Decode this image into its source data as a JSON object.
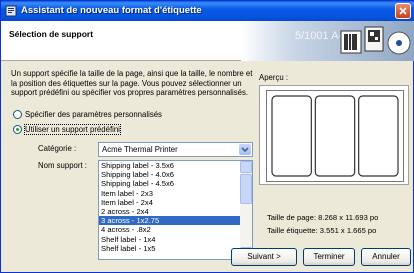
{
  "window": {
    "title": "Assistant de nouveau format d'étiquette",
    "colors": {
      "titlebar": "#0655e0",
      "selection": "#316ac5",
      "radio_dot": "#21a121"
    }
  },
  "header": {
    "title": "Sélection de support",
    "banner_text": "5/1001 A-11"
  },
  "description": "Un support spécifie la taille de la page, ainsi que la taille, le nombre et la position des étiquettes sur la page. Vous pouvez sélectionner un support prédéfini ou spécifier vos propres paramètres personnalisés.",
  "options": {
    "custom": {
      "label": "Spécifier des paramètres personnalisés",
      "selected": false
    },
    "predefined": {
      "label": "Utiliser un support prédéfini",
      "selected": true
    }
  },
  "category": {
    "label": "Catégorie :",
    "value": "Acme Thermal Printer"
  },
  "media": {
    "label": "Nom support :",
    "items": [
      "Shipping label - 3.5x6",
      "Shipping label - 4.0x6",
      "Shipping label - 4.5x6",
      "Item label - 2x3",
      "Item label - 2x4",
      "2 across - 2x4",
      "3 across - 1x2.75",
      "4 across - .8x2",
      "Shelf label - 1x4",
      "Shelf label - 1x5"
    ],
    "selected_index": 6
  },
  "preview": {
    "label": "Aperçu :",
    "label_columns": 3
  },
  "dimensions": {
    "page_label": "Taille de page:",
    "page_value": "8.268 x 11.693 po",
    "label_label": "Taille étiquette:",
    "label_value": "3.551 x 1.665 po"
  },
  "buttons": {
    "back": "< Précédent",
    "next": "Suivant >",
    "finish": "Terminer",
    "cancel": "Annuler"
  }
}
